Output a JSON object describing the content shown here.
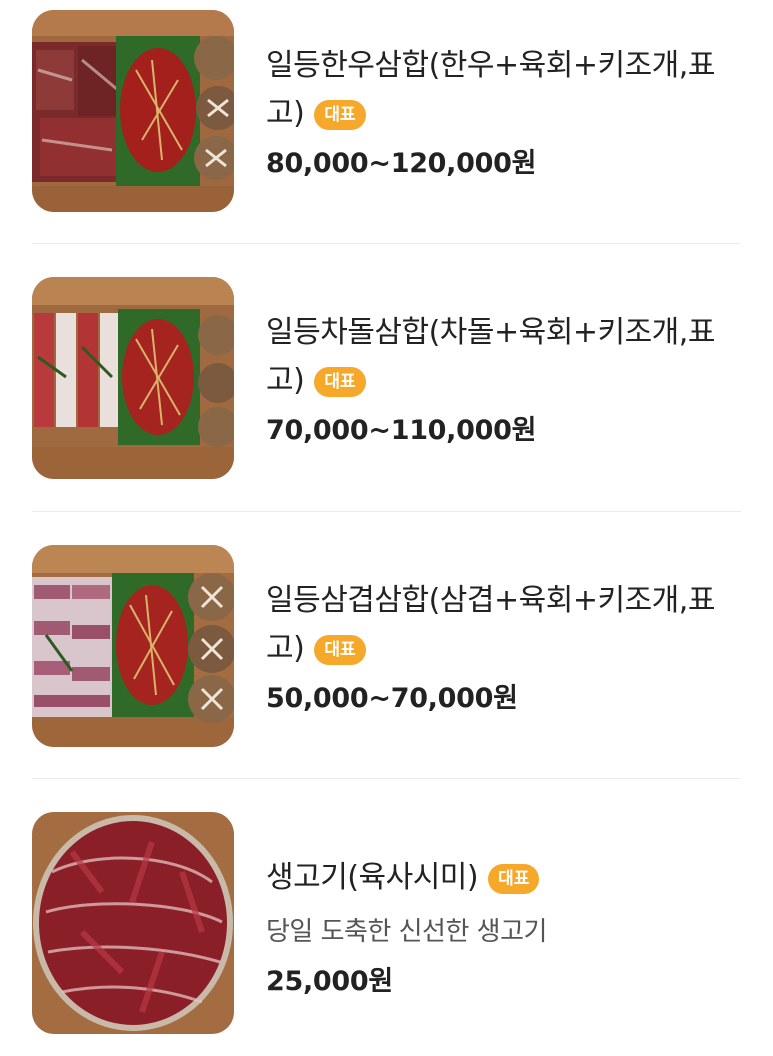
{
  "menu": {
    "items": [
      {
        "name": "일등한우삼합(한우+육회+키조개,표고)",
        "badge": "대표",
        "description": "",
        "price": "80,000~120,000원",
        "thumbnail": "hanwoo-platter"
      },
      {
        "name": "일등차돌삼합(차돌+육회+키조개,표고)",
        "badge": "대표",
        "description": "",
        "price": "70,000~110,000원",
        "thumbnail": "chadol-platter"
      },
      {
        "name": "일등삼겹삼합(삼겹+육회+키조개,표고)",
        "badge": "대표",
        "description": "",
        "price": "50,000~70,000원",
        "thumbnail": "samgyeop-platter"
      },
      {
        "name": "생고기(육사시미)",
        "badge": "대표",
        "description": "당일 도축한 신선한 생고기",
        "price": "25,000원",
        "thumbnail": "raw-beef-plate"
      }
    ]
  },
  "colors": {
    "badge": "#f5a829",
    "text": "#222222",
    "description": "#555555",
    "divider": "#ebebeb"
  }
}
